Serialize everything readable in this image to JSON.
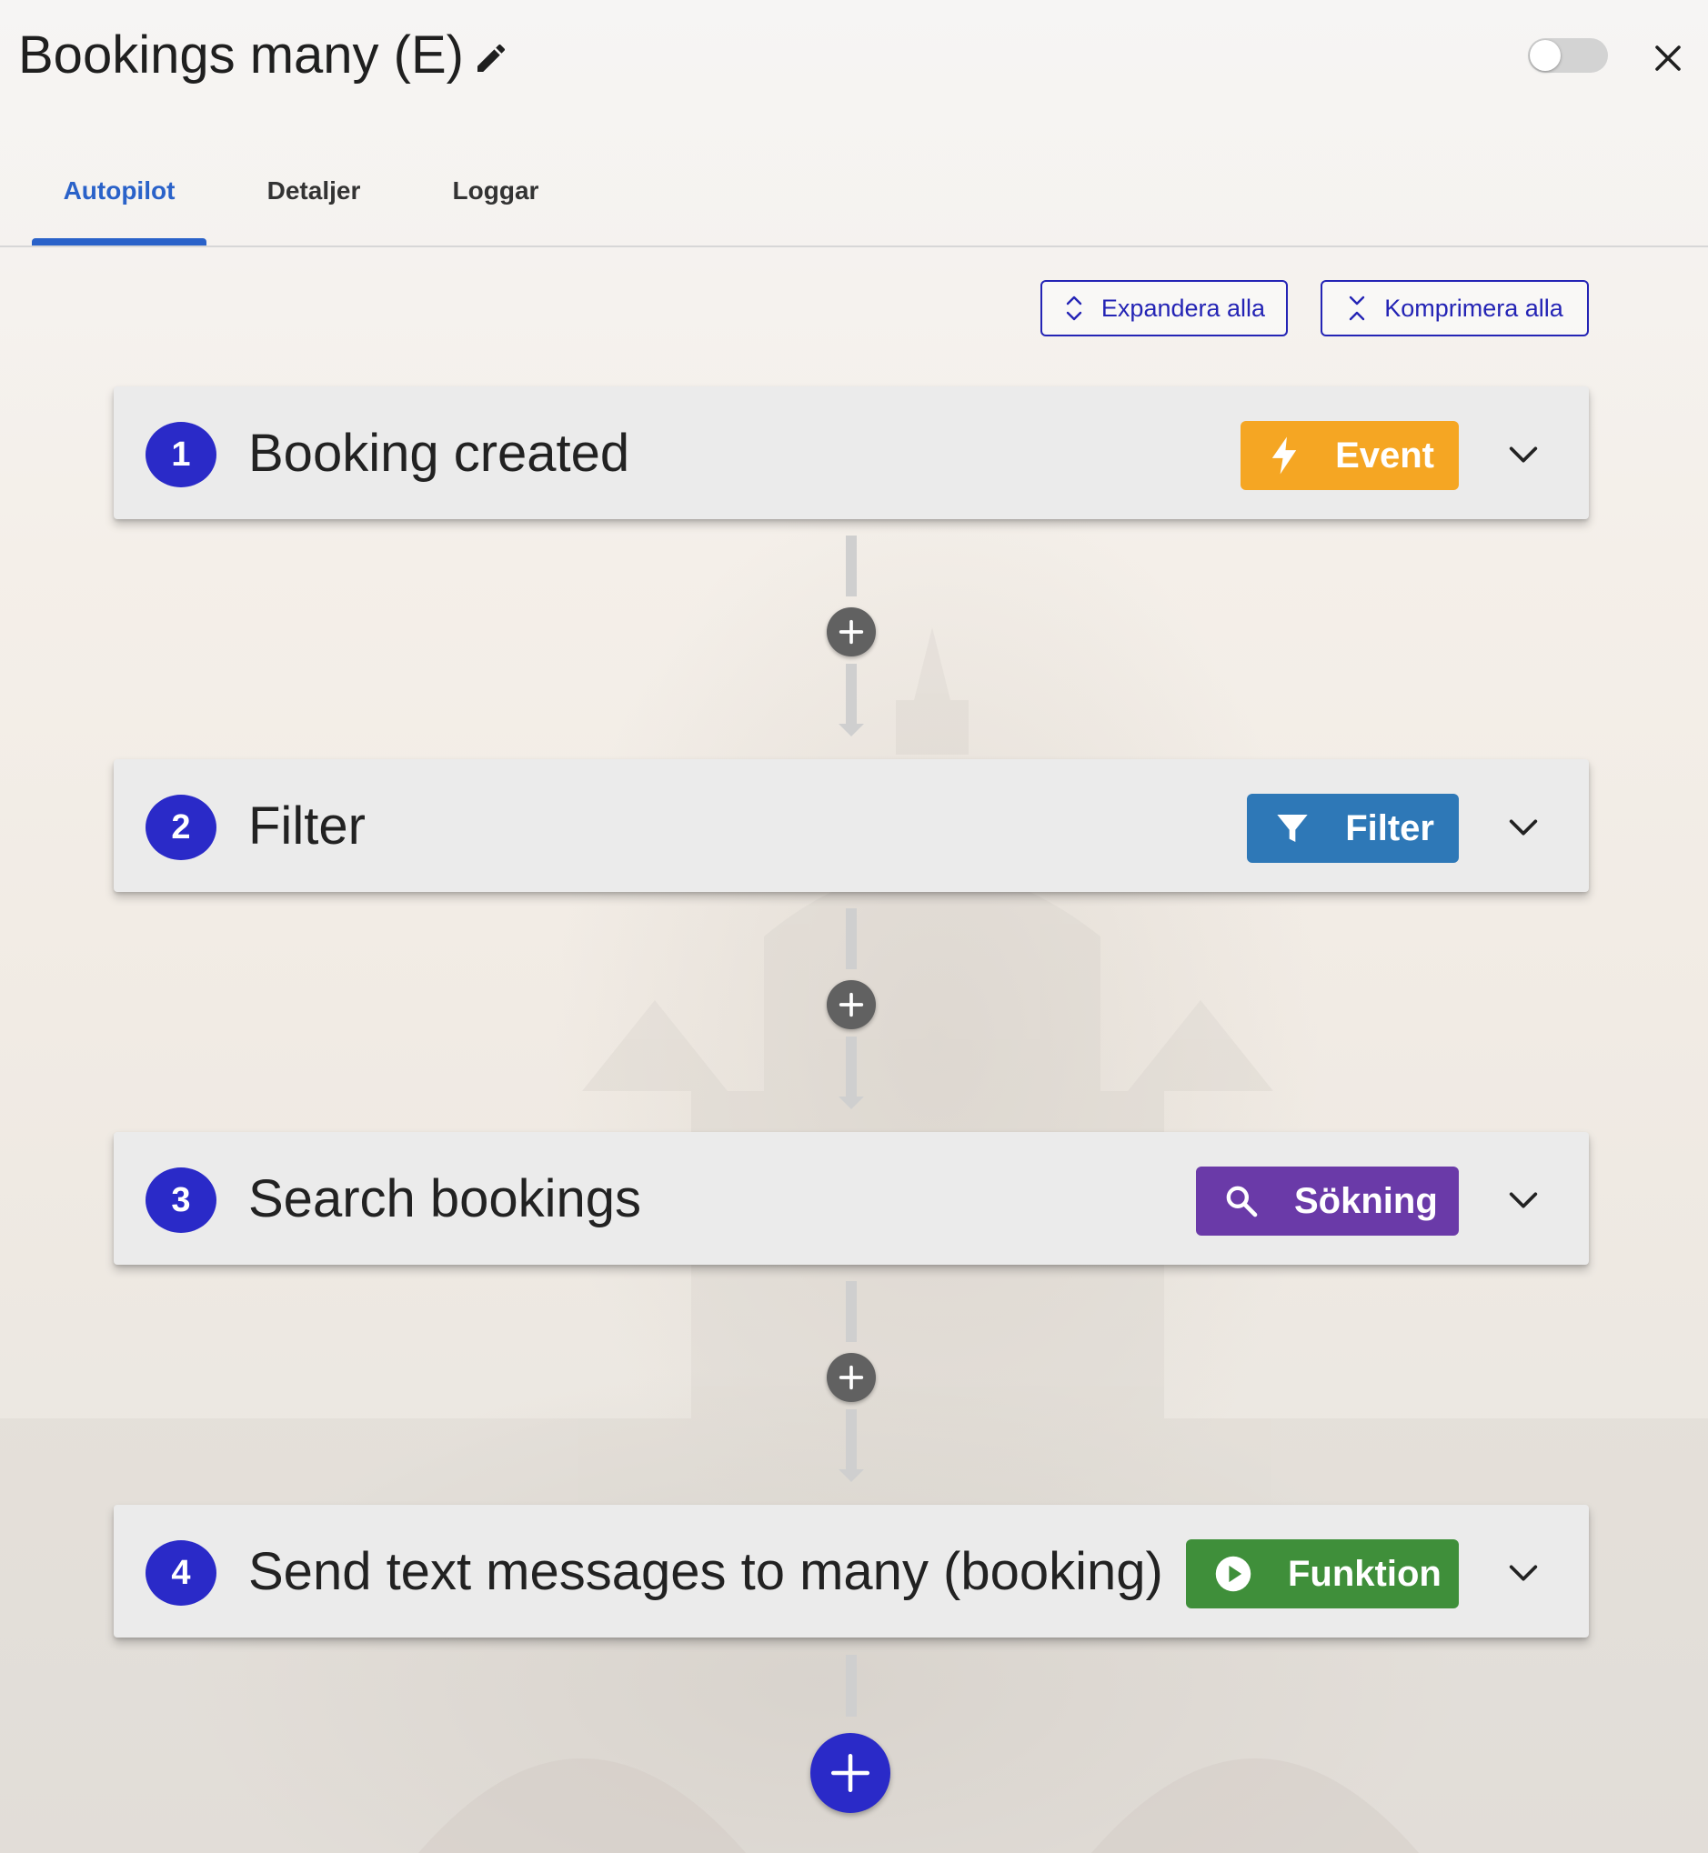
{
  "header": {
    "title": "Bookings many (E)",
    "edit_icon": "pencil-icon",
    "toggle_state": "off",
    "close_icon": "close-icon"
  },
  "tabs": [
    {
      "label": "Autopilot",
      "active": true
    },
    {
      "label": "Detaljer",
      "active": false
    },
    {
      "label": "Loggar",
      "active": false
    }
  ],
  "actions": {
    "expand_all": "Expandera alla",
    "collapse_all": "Komprimera alla"
  },
  "steps": [
    {
      "number": "1",
      "label": "Booking created",
      "badge": "Event",
      "badge_color": "#f5a623",
      "badge_icon": "lightning-icon"
    },
    {
      "number": "2",
      "label": "Filter",
      "badge": "Filter",
      "badge_color": "#2e78b7",
      "badge_icon": "funnel-icon"
    },
    {
      "number": "3",
      "label": "Search bookings",
      "badge": "Sökning",
      "badge_color": "#6a3aa8",
      "badge_icon": "search-icon"
    },
    {
      "number": "4",
      "label": "Send text messages to many (booking)",
      "badge": "Funktion",
      "badge_color": "#3f8f3a",
      "badge_icon": "play-circle-icon"
    }
  ],
  "colors": {
    "accent": "#2a2ac8",
    "tab_active": "#2a62c9"
  }
}
